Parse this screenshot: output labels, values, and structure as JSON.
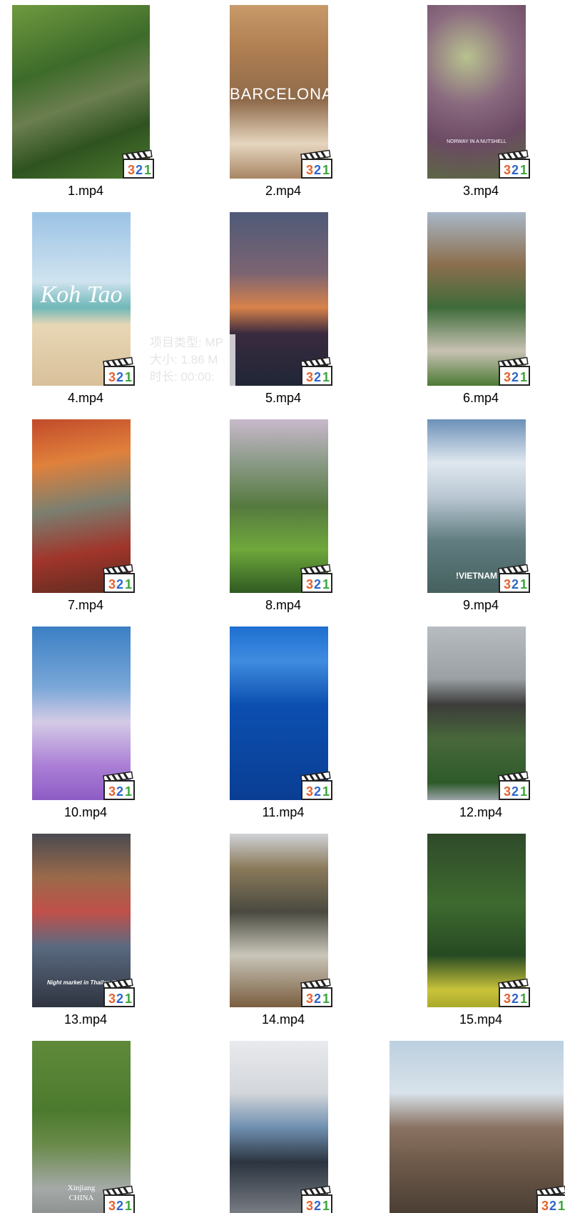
{
  "files": [
    {
      "name": "1.mp4"
    },
    {
      "name": "2.mp4",
      "overlay": "BARCELONA"
    },
    {
      "name": "3.mp4",
      "overlay": "NORWAY IN A NUTSHELL"
    },
    {
      "name": "4.mp4",
      "overlay": "Koh Tao"
    },
    {
      "name": "5.mp4"
    },
    {
      "name": "6.mp4"
    },
    {
      "name": "7.mp4"
    },
    {
      "name": "8.mp4"
    },
    {
      "name": "9.mp4",
      "overlay": "!VIETNAM"
    },
    {
      "name": "10.mp4"
    },
    {
      "name": "11.mp4"
    },
    {
      "name": "12.mp4"
    },
    {
      "name": "13.mp4",
      "overlay": "Night market in Thailand!"
    },
    {
      "name": "14.mp4"
    },
    {
      "name": "15.mp4"
    },
    {
      "name": "",
      "overlay_line1": "Xinjiang",
      "overlay_line2": "CHINA"
    },
    {
      "name": ""
    },
    {
      "name": ""
    }
  ],
  "tooltip": {
    "type": "项目类型: MP",
    "size": "大小: 1.86 M",
    "duration": "时长: 00:00:"
  },
  "badge_text": "321",
  "icon": "media-player-classic-clapperboard-icon"
}
